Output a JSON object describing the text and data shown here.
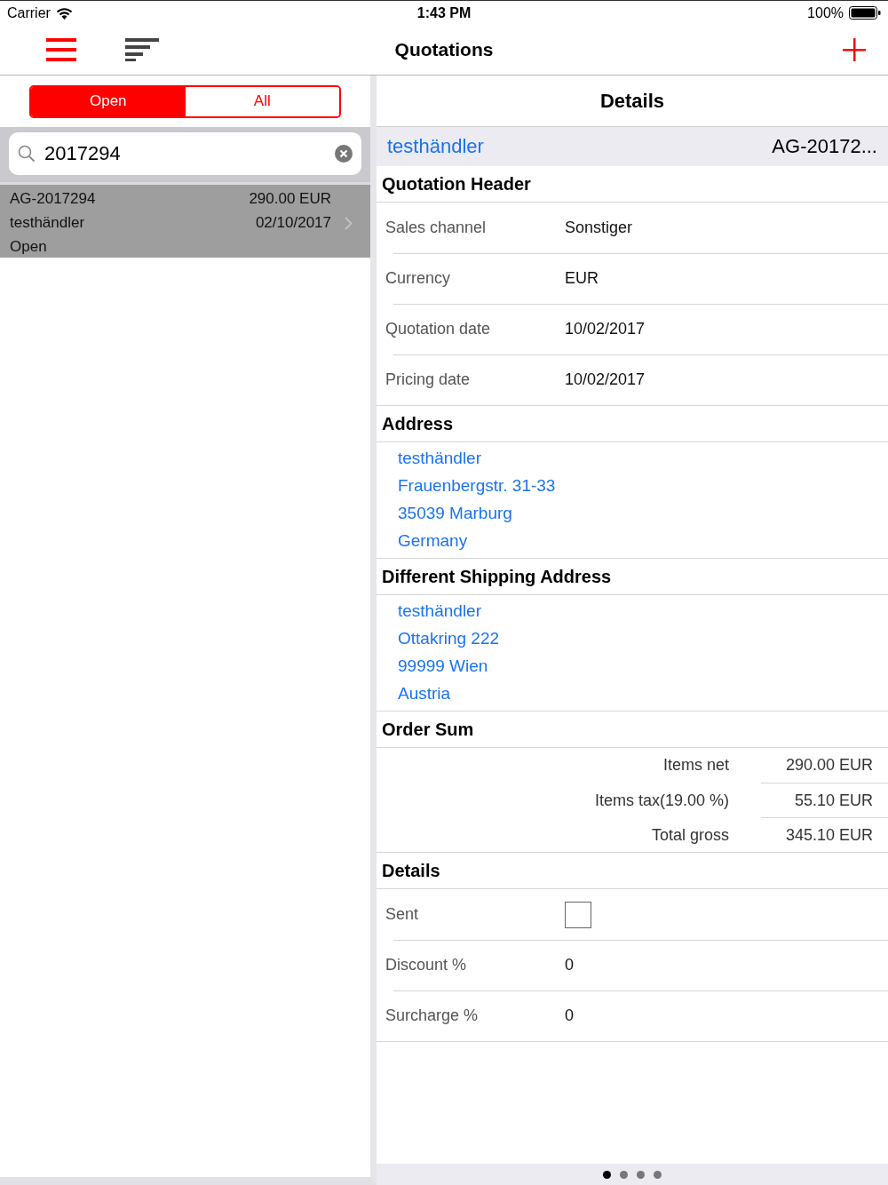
{
  "status_bar": {
    "carrier": "Carrier",
    "time": "1:43 PM",
    "battery": "100%"
  },
  "nav": {
    "title": "Quotations"
  },
  "segments": [
    {
      "label": "Open",
      "selected": true
    },
    {
      "label": "All",
      "selected": false
    }
  ],
  "search": {
    "value": "2017294"
  },
  "quotations": [
    {
      "number": "AG-2017294",
      "amount": "290.00 EUR",
      "customer": "testhändler",
      "date": "02/10/2017",
      "status": "Open",
      "selected": true
    }
  ],
  "details": {
    "title": "Details",
    "customer": "testhändler",
    "number": "AG-20172...",
    "sections": [
      {
        "title": "Quotation Header",
        "kind": "fields",
        "rows": [
          {
            "kind": "text",
            "label": "Sales channel",
            "value": "Sonstiger"
          },
          {
            "kind": "text",
            "label": "Currency",
            "value": "EUR"
          },
          {
            "kind": "text",
            "label": "Quotation date",
            "value": "10/02/2017"
          },
          {
            "kind": "text",
            "label": "Pricing date",
            "value": "10/02/2017"
          }
        ]
      },
      {
        "title": "Address",
        "kind": "address",
        "lines": [
          "testhändler",
          "Frauenbergstr. 31-33",
          "35039 Marburg",
          "Germany"
        ]
      },
      {
        "title": "Different Shipping Address",
        "kind": "address",
        "lines": [
          "testhändler",
          "Ottakring 222",
          "99999 Wien",
          "Austria"
        ]
      },
      {
        "title": "Order Sum",
        "kind": "sums",
        "rows": [
          {
            "label": "Items net",
            "value": "290.00 EUR"
          },
          {
            "label": "Items tax(19.00 %)",
            "value": "55.10 EUR"
          },
          {
            "label": "Total gross",
            "value": "345.10 EUR"
          }
        ]
      },
      {
        "title": "Details",
        "kind": "fields",
        "rows": [
          {
            "kind": "checkbox",
            "label": "Sent",
            "checked": false
          },
          {
            "kind": "text",
            "label": "Discount %",
            "value": "0"
          },
          {
            "kind": "text",
            "label": "Surcharge %",
            "value": "0"
          }
        ]
      }
    ]
  },
  "page_dots": [
    {
      "selected": true
    },
    {
      "selected": false
    },
    {
      "selected": false
    },
    {
      "selected": false
    }
  ]
}
